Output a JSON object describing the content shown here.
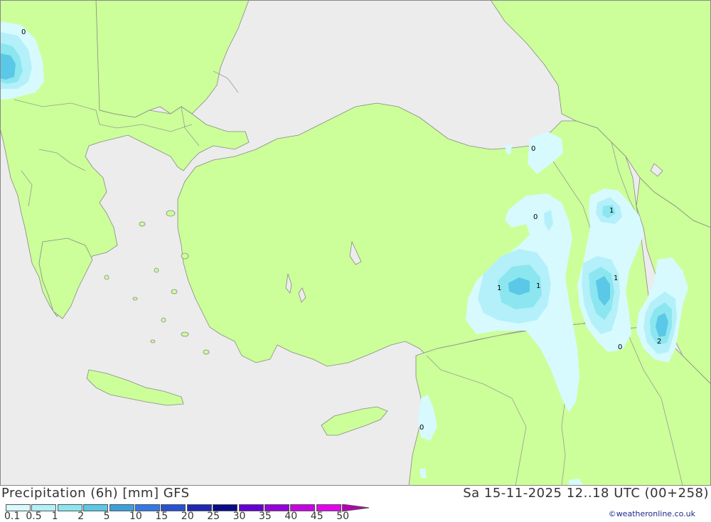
{
  "title": "Precipitation (6h) [mm] GFS",
  "datetime": "Sa 15-11-2025 12..18 UTC (00+258)",
  "credit": "©weatheronline.co.uk",
  "colors": {
    "sea": "#ececec",
    "land": "#ccff99",
    "border": "#999999",
    "coast": "#888888"
  },
  "legend": {
    "labels": [
      "0.1",
      "0.5",
      "1",
      "2",
      "5",
      "10",
      "15",
      "20",
      "25",
      "30",
      "35",
      "40",
      "45",
      "50"
    ],
    "colors": [
      "#d6fafe",
      "#b4f0fa",
      "#8ce6f0",
      "#5ac8e6",
      "#3ca0dc",
      "#3278e6",
      "#2850d2",
      "#1e28b4",
      "#0a0a8c",
      "#6400d2",
      "#9600dc",
      "#c800e6",
      "#e600f0",
      "#b400b4"
    ]
  },
  "contour_labels": [
    {
      "text": "0"
    },
    {
      "text": "0"
    },
    {
      "text": "0"
    },
    {
      "text": "1"
    },
    {
      "text": "1"
    },
    {
      "text": "1"
    },
    {
      "text": "1"
    },
    {
      "text": "0"
    },
    {
      "text": "2"
    },
    {
      "text": "0"
    }
  ]
}
